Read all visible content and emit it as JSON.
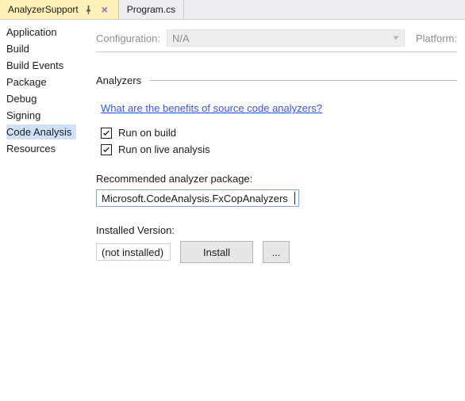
{
  "tabs": {
    "active": {
      "label": "AnalyzerSupport"
    },
    "other": {
      "label": "Program.cs"
    }
  },
  "sidebar": {
    "items": [
      {
        "label": "Application"
      },
      {
        "label": "Build"
      },
      {
        "label": "Build Events"
      },
      {
        "label": "Package"
      },
      {
        "label": "Debug"
      },
      {
        "label": "Signing"
      },
      {
        "label": "Code Analysis"
      },
      {
        "label": "Resources"
      }
    ],
    "selected_index": 6
  },
  "config": {
    "label": "Configuration:",
    "value": "N/A",
    "platform_label": "Platform:"
  },
  "analyzers": {
    "heading": "Analyzers",
    "benefits_link": "What are the benefits of source code analyzers?",
    "run_on_build": {
      "label": "Run on build",
      "checked": true
    },
    "run_on_live": {
      "label": "Run on live analysis",
      "checked": true
    },
    "package_label": "Recommended analyzer package:",
    "package_value": "Microsoft.CodeAnalysis.FxCopAnalyzers",
    "installed_label": "Installed Version:",
    "installed_value": "(not installed)",
    "install_btn": "Install",
    "more_btn": "..."
  }
}
